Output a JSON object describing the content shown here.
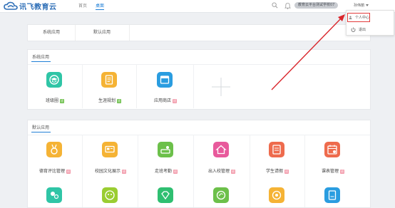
{
  "header": {
    "logo_text": "讯飞教育云",
    "nav": [
      {
        "label": "首页",
        "active": false
      },
      {
        "label": "桌面",
        "active": true
      }
    ],
    "school": "教育云平台测试学校07",
    "user": "孙伟丽"
  },
  "dropdown": {
    "items": [
      {
        "label": "个人中心",
        "icon": "user-icon"
      },
      {
        "label": "退出",
        "icon": "power-icon"
      }
    ]
  },
  "tabs": [
    "系统应用",
    "默认应用"
  ],
  "system_apps": {
    "title": "系统应用",
    "items": [
      {
        "label": "班级圈",
        "badge": "班",
        "badge_color": "green",
        "color": "#2fc5a6",
        "icon": "graduation-icon"
      },
      {
        "label": "生涯规划",
        "badge": "班",
        "badge_color": "green",
        "color": "#f5b335",
        "icon": "document-icon"
      },
      {
        "label": "应用商店",
        "badge": "班",
        "badge_color": "pink",
        "color": "#2a9de0",
        "icon": "store-icon"
      }
    ]
  },
  "default_apps": {
    "title": "默认应用",
    "items": [
      {
        "label": "德育评比管理",
        "badge": "班",
        "badge_color": "pink",
        "color": "#f5b335",
        "icon": "medal-icon"
      },
      {
        "label": "校园文化展示",
        "badge": "班",
        "badge_color": "pink",
        "color": "#f5b335",
        "icon": "display-icon"
      },
      {
        "label": "走班考勤",
        "badge": "班",
        "badge_color": "pink",
        "color": "#6cc04a",
        "icon": "checkin-icon"
      },
      {
        "label": "出入校管理",
        "badge": "班",
        "badge_color": "pink",
        "color": "#e85a9c",
        "icon": "house-icon"
      },
      {
        "label": "学生请假",
        "badge": "班",
        "badge_color": "pink",
        "color": "#ee6b4d",
        "icon": "leave-icon"
      },
      {
        "label": "课表管理",
        "badge": "班",
        "badge_color": "pink",
        "color": "#ee6b4d",
        "icon": "calendar-icon"
      }
    ],
    "row2_icons": [
      {
        "color": "#2fc5a6",
        "icon": "people-icon"
      },
      {
        "color": "#9acd32",
        "icon": "face-icon"
      },
      {
        "color": "#2fbf71",
        "icon": "diamond-icon"
      },
      {
        "color": "#6cc04a",
        "icon": "leaf-icon"
      },
      {
        "color": "#f5b335",
        "icon": "target-icon"
      },
      {
        "color": "#2a9de0",
        "icon": "doc-icon"
      }
    ]
  },
  "colors": {
    "accent": "#1f7fd6",
    "arrow": "#d9262c"
  }
}
